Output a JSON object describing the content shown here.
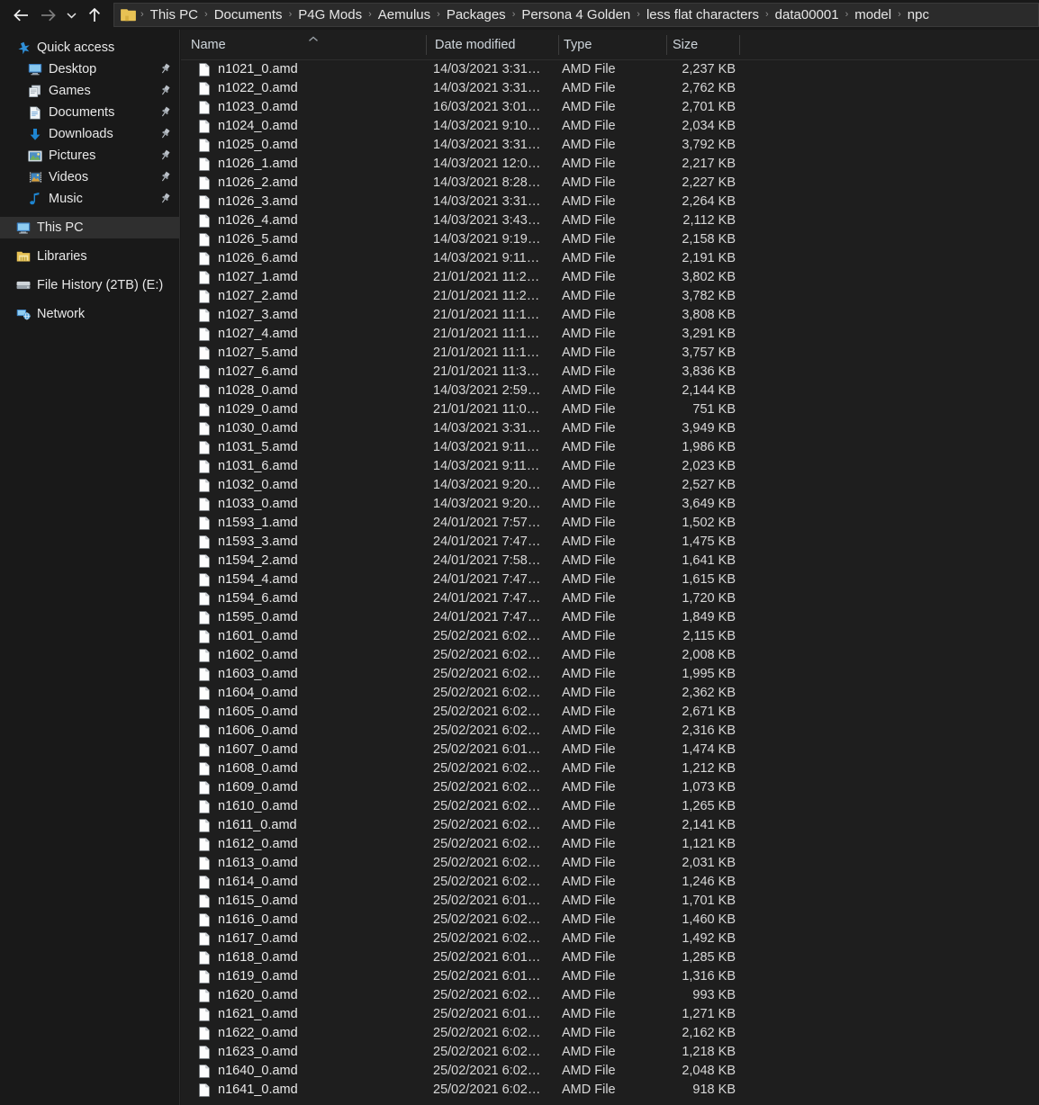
{
  "titlebar": {
    "nav": {
      "back_label": "Back",
      "forward_label": "Forward",
      "recent_label": "Recent locations",
      "up_label": "Up one level"
    },
    "folder_icon": "folder-icon",
    "separator": "›",
    "breadcrumbs": [
      "This PC",
      "Documents",
      "P4G Mods",
      "Aemulus",
      "Packages",
      "Persona 4 Golden",
      "less flat characters",
      "data00001",
      "model",
      "npc"
    ]
  },
  "sidebar": {
    "items": [
      {
        "label": "Quick access",
        "icon": "star-icon",
        "level": "root",
        "pinned": false,
        "selected": false
      },
      {
        "label": "Desktop",
        "icon": "monitor-icon",
        "level": "lvl1",
        "pinned": true,
        "selected": false
      },
      {
        "label": "Games",
        "icon": "games-icon",
        "level": "lvl1",
        "pinned": true,
        "selected": false
      },
      {
        "label": "Documents",
        "icon": "document-icon",
        "level": "lvl1",
        "pinned": true,
        "selected": false
      },
      {
        "label": "Downloads",
        "icon": "download-icon",
        "level": "lvl1",
        "pinned": true,
        "selected": false
      },
      {
        "label": "Pictures",
        "icon": "pictures-icon",
        "level": "lvl1",
        "pinned": true,
        "selected": false
      },
      {
        "label": "Videos",
        "icon": "videos-icon",
        "level": "lvl1",
        "pinned": true,
        "selected": false
      },
      {
        "label": "Music",
        "icon": "music-icon",
        "level": "lvl1",
        "pinned": true,
        "selected": false
      },
      {
        "label": "This PC",
        "icon": "thispc-icon",
        "level": "root",
        "pinned": false,
        "selected": true
      },
      {
        "label": "Libraries",
        "icon": "libraries-icon",
        "level": "root",
        "pinned": false,
        "selected": false
      },
      {
        "label": "File History (2TB) (E:)",
        "icon": "drive-icon",
        "level": "root",
        "pinned": false,
        "selected": false
      },
      {
        "label": "Network",
        "icon": "network-icon",
        "level": "root",
        "pinned": false,
        "selected": false
      }
    ]
  },
  "filelist": {
    "columns": [
      {
        "key": "name",
        "label": "Name",
        "sorted": "asc"
      },
      {
        "key": "date",
        "label": "Date modified",
        "sorted": ""
      },
      {
        "key": "type",
        "label": "Type",
        "sorted": ""
      },
      {
        "key": "size",
        "label": "Size",
        "sorted": ""
      }
    ],
    "rows": [
      {
        "name": "n1021_0.amd",
        "date": "14/03/2021 3:31…",
        "type": "AMD File",
        "size": "2,237 KB"
      },
      {
        "name": "n1022_0.amd",
        "date": "14/03/2021 3:31…",
        "type": "AMD File",
        "size": "2,762 KB"
      },
      {
        "name": "n1023_0.amd",
        "date": "16/03/2021 3:01…",
        "type": "AMD File",
        "size": "2,701 KB"
      },
      {
        "name": "n1024_0.amd",
        "date": "14/03/2021 9:10…",
        "type": "AMD File",
        "size": "2,034 KB"
      },
      {
        "name": "n1025_0.amd",
        "date": "14/03/2021 3:31…",
        "type": "AMD File",
        "size": "3,792 KB"
      },
      {
        "name": "n1026_1.amd",
        "date": "14/03/2021 12:0…",
        "type": "AMD File",
        "size": "2,217 KB"
      },
      {
        "name": "n1026_2.amd",
        "date": "14/03/2021 8:28…",
        "type": "AMD File",
        "size": "2,227 KB"
      },
      {
        "name": "n1026_3.amd",
        "date": "14/03/2021 3:31…",
        "type": "AMD File",
        "size": "2,264 KB"
      },
      {
        "name": "n1026_4.amd",
        "date": "14/03/2021 3:43…",
        "type": "AMD File",
        "size": "2,112 KB"
      },
      {
        "name": "n1026_5.amd",
        "date": "14/03/2021 9:19…",
        "type": "AMD File",
        "size": "2,158 KB"
      },
      {
        "name": "n1026_6.amd",
        "date": "14/03/2021 9:11…",
        "type": "AMD File",
        "size": "2,191 KB"
      },
      {
        "name": "n1027_1.amd",
        "date": "21/01/2021 11:2…",
        "type": "AMD File",
        "size": "3,802 KB"
      },
      {
        "name": "n1027_2.amd",
        "date": "21/01/2021 11:2…",
        "type": "AMD File",
        "size": "3,782 KB"
      },
      {
        "name": "n1027_3.amd",
        "date": "21/01/2021 11:1…",
        "type": "AMD File",
        "size": "3,808 KB"
      },
      {
        "name": "n1027_4.amd",
        "date": "21/01/2021 11:1…",
        "type": "AMD File",
        "size": "3,291 KB"
      },
      {
        "name": "n1027_5.amd",
        "date": "21/01/2021 11:1…",
        "type": "AMD File",
        "size": "3,757 KB"
      },
      {
        "name": "n1027_6.amd",
        "date": "21/01/2021 11:3…",
        "type": "AMD File",
        "size": "3,836 KB"
      },
      {
        "name": "n1028_0.amd",
        "date": "14/03/2021 2:59…",
        "type": "AMD File",
        "size": "2,144 KB"
      },
      {
        "name": "n1029_0.amd",
        "date": "21/01/2021 11:0…",
        "type": "AMD File",
        "size": "751 KB"
      },
      {
        "name": "n1030_0.amd",
        "date": "14/03/2021 3:31…",
        "type": "AMD File",
        "size": "3,949 KB"
      },
      {
        "name": "n1031_5.amd",
        "date": "14/03/2021 9:11…",
        "type": "AMD File",
        "size": "1,986 KB"
      },
      {
        "name": "n1031_6.amd",
        "date": "14/03/2021 9:11…",
        "type": "AMD File",
        "size": "2,023 KB"
      },
      {
        "name": "n1032_0.amd",
        "date": "14/03/2021 9:20…",
        "type": "AMD File",
        "size": "2,527 KB"
      },
      {
        "name": "n1033_0.amd",
        "date": "14/03/2021 9:20…",
        "type": "AMD File",
        "size": "3,649 KB"
      },
      {
        "name": "n1593_1.amd",
        "date": "24/01/2021 7:57…",
        "type": "AMD File",
        "size": "1,502 KB"
      },
      {
        "name": "n1593_3.amd",
        "date": "24/01/2021 7:47…",
        "type": "AMD File",
        "size": "1,475 KB"
      },
      {
        "name": "n1594_2.amd",
        "date": "24/01/2021 7:58…",
        "type": "AMD File",
        "size": "1,641 KB"
      },
      {
        "name": "n1594_4.amd",
        "date": "24/01/2021 7:47…",
        "type": "AMD File",
        "size": "1,615 KB"
      },
      {
        "name": "n1594_6.amd",
        "date": "24/01/2021 7:47…",
        "type": "AMD File",
        "size": "1,720 KB"
      },
      {
        "name": "n1595_0.amd",
        "date": "24/01/2021 7:47…",
        "type": "AMD File",
        "size": "1,849 KB"
      },
      {
        "name": "n1601_0.amd",
        "date": "25/02/2021 6:02…",
        "type": "AMD File",
        "size": "2,115 KB"
      },
      {
        "name": "n1602_0.amd",
        "date": "25/02/2021 6:02…",
        "type": "AMD File",
        "size": "2,008 KB"
      },
      {
        "name": "n1603_0.amd",
        "date": "25/02/2021 6:02…",
        "type": "AMD File",
        "size": "1,995 KB"
      },
      {
        "name": "n1604_0.amd",
        "date": "25/02/2021 6:02…",
        "type": "AMD File",
        "size": "2,362 KB"
      },
      {
        "name": "n1605_0.amd",
        "date": "25/02/2021 6:02…",
        "type": "AMD File",
        "size": "2,671 KB"
      },
      {
        "name": "n1606_0.amd",
        "date": "25/02/2021 6:02…",
        "type": "AMD File",
        "size": "2,316 KB"
      },
      {
        "name": "n1607_0.amd",
        "date": "25/02/2021 6:01…",
        "type": "AMD File",
        "size": "1,474 KB"
      },
      {
        "name": "n1608_0.amd",
        "date": "25/02/2021 6:02…",
        "type": "AMD File",
        "size": "1,212 KB"
      },
      {
        "name": "n1609_0.amd",
        "date": "25/02/2021 6:02…",
        "type": "AMD File",
        "size": "1,073 KB"
      },
      {
        "name": "n1610_0.amd",
        "date": "25/02/2021 6:02…",
        "type": "AMD File",
        "size": "1,265 KB"
      },
      {
        "name": "n1611_0.amd",
        "date": "25/02/2021 6:02…",
        "type": "AMD File",
        "size": "2,141 KB"
      },
      {
        "name": "n1612_0.amd",
        "date": "25/02/2021 6:02…",
        "type": "AMD File",
        "size": "1,121 KB"
      },
      {
        "name": "n1613_0.amd",
        "date": "25/02/2021 6:02…",
        "type": "AMD File",
        "size": "2,031 KB"
      },
      {
        "name": "n1614_0.amd",
        "date": "25/02/2021 6:02…",
        "type": "AMD File",
        "size": "1,246 KB"
      },
      {
        "name": "n1615_0.amd",
        "date": "25/02/2021 6:01…",
        "type": "AMD File",
        "size": "1,701 KB"
      },
      {
        "name": "n1616_0.amd",
        "date": "25/02/2021 6:02…",
        "type": "AMD File",
        "size": "1,460 KB"
      },
      {
        "name": "n1617_0.amd",
        "date": "25/02/2021 6:02…",
        "type": "AMD File",
        "size": "1,492 KB"
      },
      {
        "name": "n1618_0.amd",
        "date": "25/02/2021 6:01…",
        "type": "AMD File",
        "size": "1,285 KB"
      },
      {
        "name": "n1619_0.amd",
        "date": "25/02/2021 6:01…",
        "type": "AMD File",
        "size": "1,316 KB"
      },
      {
        "name": "n1620_0.amd",
        "date": "25/02/2021 6:02…",
        "type": "AMD File",
        "size": "993 KB"
      },
      {
        "name": "n1621_0.amd",
        "date": "25/02/2021 6:01…",
        "type": "AMD File",
        "size": "1,271 KB"
      },
      {
        "name": "n1622_0.amd",
        "date": "25/02/2021 6:02…",
        "type": "AMD File",
        "size": "2,162 KB"
      },
      {
        "name": "n1623_0.amd",
        "date": "25/02/2021 6:02…",
        "type": "AMD File",
        "size": "1,218 KB"
      },
      {
        "name": "n1640_0.amd",
        "date": "25/02/2021 6:02…",
        "type": "AMD File",
        "size": "2,048 KB"
      },
      {
        "name": "n1641_0.amd",
        "date": "25/02/2021 6:02…",
        "type": "AMD File",
        "size": "918 KB"
      }
    ]
  },
  "colors": {
    "window_bg": "#191919",
    "pane_bg": "#1e1e1e",
    "text": "#e9e9e9",
    "header_text": "#cfd6dc",
    "selected_row": "#2f2f2f",
    "folder_yellow": "#e8c254",
    "accent_blue": "#2f8fd8"
  }
}
